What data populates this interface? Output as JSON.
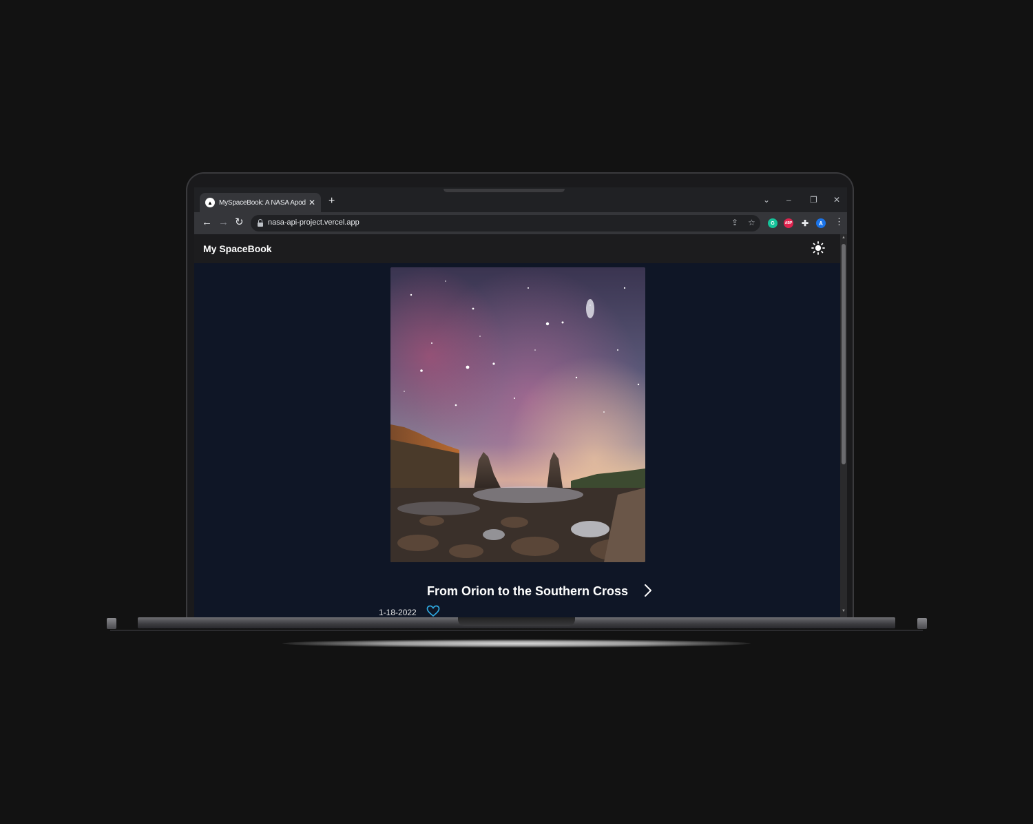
{
  "browser": {
    "tab_title": "MySpaceBook: A NASA Apod Image",
    "tab_favicon": "▲",
    "url": "nasa-api-project.vercel.app",
    "extensions": [
      {
        "name": "grammarly-icon",
        "label": "G",
        "color": "#15c39a"
      },
      {
        "name": "adblock-icon",
        "label": "ABP",
        "color": "#e0234e"
      },
      {
        "name": "profile-avatar",
        "label": "A",
        "color": "#1a73e8"
      }
    ]
  },
  "app": {
    "brand": "My SpaceBook",
    "theme_icon": "sun-icon"
  },
  "apod": {
    "title": "From Orion to the Southern Cross",
    "date": "1-18-2022",
    "liked": false
  },
  "colors": {
    "page_bg": "#0f1626",
    "navbar_bg": "#1c1c1e",
    "heart": "#2fa8e0"
  }
}
